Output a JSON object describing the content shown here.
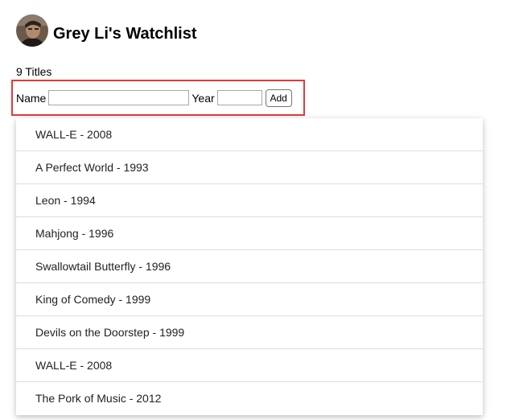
{
  "header": {
    "title": "Grey Li's Watchlist",
    "avatar_icon": "user-avatar-photo"
  },
  "count_text": "9 Titles",
  "form": {
    "name_label": "Name",
    "name_value": "",
    "year_label": "Year",
    "year_value": "",
    "add_label": "Add",
    "highlight_color": "#e53935"
  },
  "movies": [
    "WALL-E - 2008",
    "A Perfect World - 1993",
    "Leon - 1994",
    "Mahjong - 1996",
    "Swallowtail Butterfly - 1996",
    "King of Comedy - 1999",
    "Devils on the Doorstep - 1999",
    "WALL-E - 2008",
    "The Pork of Music - 2012"
  ]
}
